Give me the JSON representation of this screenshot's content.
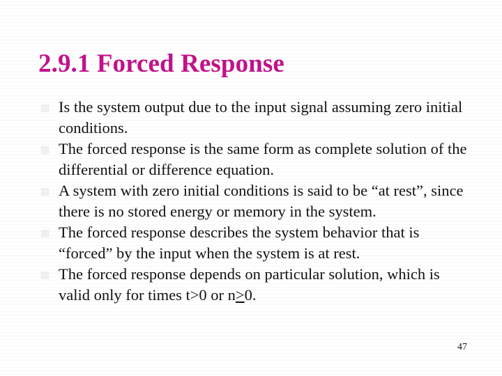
{
  "slide": {
    "title": "2.9.1 Forced Response",
    "title_color": "#C2128C",
    "background_color": "#FFFFFF",
    "body_text_color": "#111111",
    "page_number": "47",
    "bullet_marker_icon": "square-bullet-icon",
    "bullets": [
      {
        "text": "Is the system output due to the input signal assuming zero initial conditions."
      },
      {
        "text": "The forced response is the same form as complete solution of the differential or difference equation."
      },
      {
        "text": "A system with zero initial conditions is said to be “at rest”, since there is no stored energy or memory in the system."
      },
      {
        "text": "The forced response describes the system behavior that is “forced” by the input when the system is at rest."
      },
      {
        "text_before": "The forced response depends on particular solution, which is valid only for times t>0 or n",
        "text_symbol": ">",
        "text_after": "0."
      }
    ]
  }
}
